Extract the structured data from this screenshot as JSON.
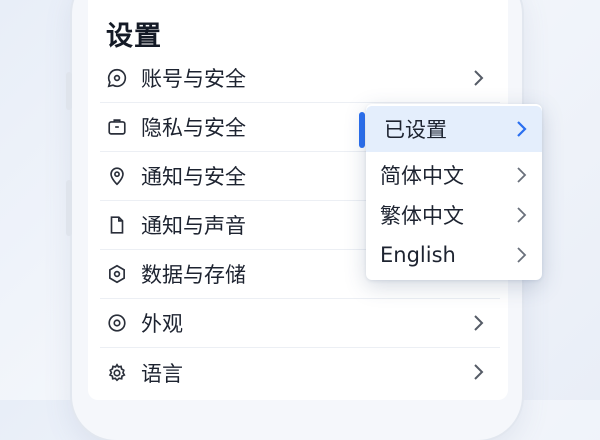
{
  "page": {
    "title": "设置"
  },
  "settings": {
    "items": [
      {
        "label": "账号与安全",
        "icon": "chat-bubble-icon"
      },
      {
        "label": "隐私与安全",
        "icon": "briefcase-icon"
      },
      {
        "label": "通知与安全",
        "icon": "location-pin-icon"
      },
      {
        "label": "通知与声音",
        "icon": "document-icon"
      },
      {
        "label": "数据与存储",
        "icon": "hexagon-icon"
      },
      {
        "label": "外观",
        "icon": "circle-icon"
      },
      {
        "label": "语言",
        "icon": "gear-icon"
      }
    ]
  },
  "language_menu": {
    "selected": "已设置",
    "options": [
      "简体中文",
      "繁体中文",
      "English"
    ],
    "accent_color": "#2a6ff0",
    "selected_bg": "#e4eefc"
  }
}
